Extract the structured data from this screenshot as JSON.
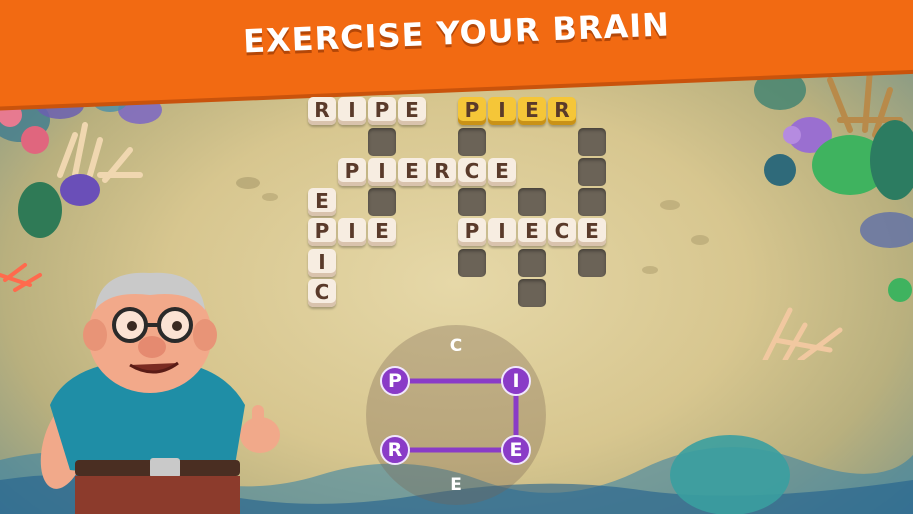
{
  "banner": {
    "title": "EXERCISE YOUR BRAIN",
    "color": "#f26a12"
  },
  "board": {
    "solved_color": "#f7ede1",
    "highlight_color": "#f5c638",
    "empty_color": "#6b6357",
    "words": [
      {
        "word": "RIPE",
        "letters": [
          "R",
          "I",
          "P",
          "E"
        ],
        "direction": "across",
        "state": "solved"
      },
      {
        "word": "PIER",
        "letters": [
          "P",
          "I",
          "E",
          "R"
        ],
        "direction": "across",
        "state": "highlighted"
      },
      {
        "word": "PIERCE",
        "letters": [
          "P",
          "I",
          "E",
          "R",
          "C",
          "E"
        ],
        "direction": "across",
        "state": "solved"
      },
      {
        "word": "PIE",
        "letters": [
          "P",
          "I",
          "E"
        ],
        "direction": "across",
        "state": "solved"
      },
      {
        "word": "PIECE",
        "letters": [
          "P",
          "I",
          "E",
          "C",
          "E"
        ],
        "direction": "across",
        "state": "solved"
      },
      {
        "word": "EPIC",
        "letters": [
          "E",
          "P",
          "I",
          "C"
        ],
        "direction": "down",
        "state": "solved"
      }
    ]
  },
  "wheel": {
    "letters": [
      {
        "letter": "C",
        "selected": false
      },
      {
        "letter": "I",
        "selected": true
      },
      {
        "letter": "E",
        "selected": true
      },
      {
        "letter": "E",
        "selected": false
      },
      {
        "letter": "R",
        "selected": true
      },
      {
        "letter": "P",
        "selected": true
      }
    ],
    "selected_path": [
      "P",
      "I",
      "E",
      "R"
    ],
    "selection_color": "#8a3bc7"
  },
  "character": {
    "icon": "grandpa-mascot-icon"
  }
}
